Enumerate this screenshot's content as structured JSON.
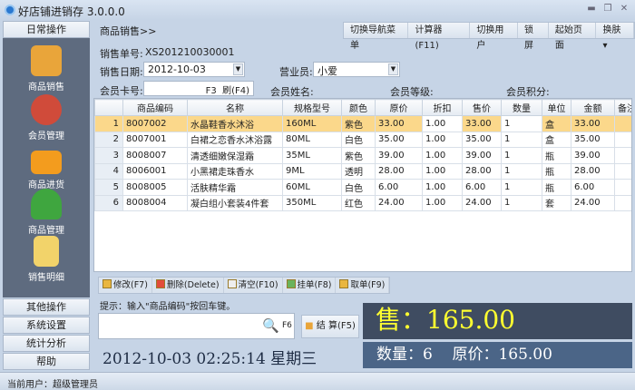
{
  "app": {
    "title": "好店铺进销存 3.0.0.0"
  },
  "sidebar": {
    "header": "日常操作",
    "items": [
      {
        "label": "商品销售",
        "color": "#e9a53a"
      },
      {
        "label": "会员管理",
        "color": "#d04b3a"
      },
      {
        "label": "商品进货",
        "color": "#f39c1e"
      },
      {
        "label": "商品管理",
        "color": "#3fa63f"
      },
      {
        "label": "销售明细",
        "color": "#f2d36a"
      }
    ],
    "sections": [
      "其他操作",
      "系统设置",
      "统计分析",
      "帮助"
    ]
  },
  "breadcrumb": "商品销售>>",
  "toolbar": [
    "切换导航菜单",
    "计算器(F11)",
    "切换用户",
    "锁屏",
    "起始页面",
    "换肤 ▾"
  ],
  "form": {
    "sale_no_label": "销售单号:",
    "sale_no": "XS201210030001",
    "date_label": "销售日期:",
    "date": "2012-10-03",
    "clerk_label": "营业员:",
    "clerk": "小爱",
    "card_label": "会员卡号:",
    "card_f3": "F3",
    "card_refresh": "刷(F4)",
    "name_label": "会员姓名:",
    "level_label": "会员等级:",
    "points_label": "会员积分:"
  },
  "table": {
    "headers": [
      "",
      "商品编码",
      "名称",
      "规格型号",
      "颜色",
      "原价",
      "折扣",
      "售价",
      "数量",
      "单位",
      "金额",
      "备注"
    ],
    "rows": [
      [
        "1",
        "8007002",
        "水晶鞋香水沐浴",
        "160ML",
        "紫色",
        "33.00",
        "1.00",
        "33.00",
        "1",
        "盒",
        "33.00",
        ""
      ],
      [
        "2",
        "8007001",
        "白裙之恋香水沐浴露",
        "80ML",
        "白色",
        "35.00",
        "1.00",
        "35.00",
        "1",
        "盒",
        "35.00",
        ""
      ],
      [
        "3",
        "8008007",
        "清透细嫩保湿霜",
        "35ML",
        "紫色",
        "39.00",
        "1.00",
        "39.00",
        "1",
        "瓶",
        "39.00",
        ""
      ],
      [
        "4",
        "8006001",
        "小黑裙走珠香水",
        "9ML",
        "透明",
        "28.00",
        "1.00",
        "28.00",
        "1",
        "瓶",
        "28.00",
        ""
      ],
      [
        "5",
        "8008005",
        "活肤精华霜",
        "60ML",
        "白色",
        "6.00",
        "1.00",
        "6.00",
        "1",
        "瓶",
        "6.00",
        ""
      ],
      [
        "6",
        "8008004",
        "凝白组小套装4件套",
        "350ML",
        "红色",
        "24.00",
        "1.00",
        "24.00",
        "1",
        "套",
        "24.00",
        ""
      ]
    ]
  },
  "actions": [
    "修改(F7)",
    "删除(Delete)",
    "清空(F10)",
    "挂单(F8)",
    "取单(F9)"
  ],
  "hint": "提示：输入\"商品编码\"按回车键。",
  "scan": {
    "value": "",
    "shortcut": "F6"
  },
  "checkout": "结 算(F5)",
  "clock": "2012-10-03 02:25:14  星期三",
  "totals": {
    "sale_label": "售：",
    "sale": "165.00",
    "qty_label": "数量：",
    "qty": "6",
    "orig_label": "原价：",
    "orig": "165.00"
  },
  "status": {
    "user_label": "当前用户：",
    "user": "超级管理员"
  }
}
